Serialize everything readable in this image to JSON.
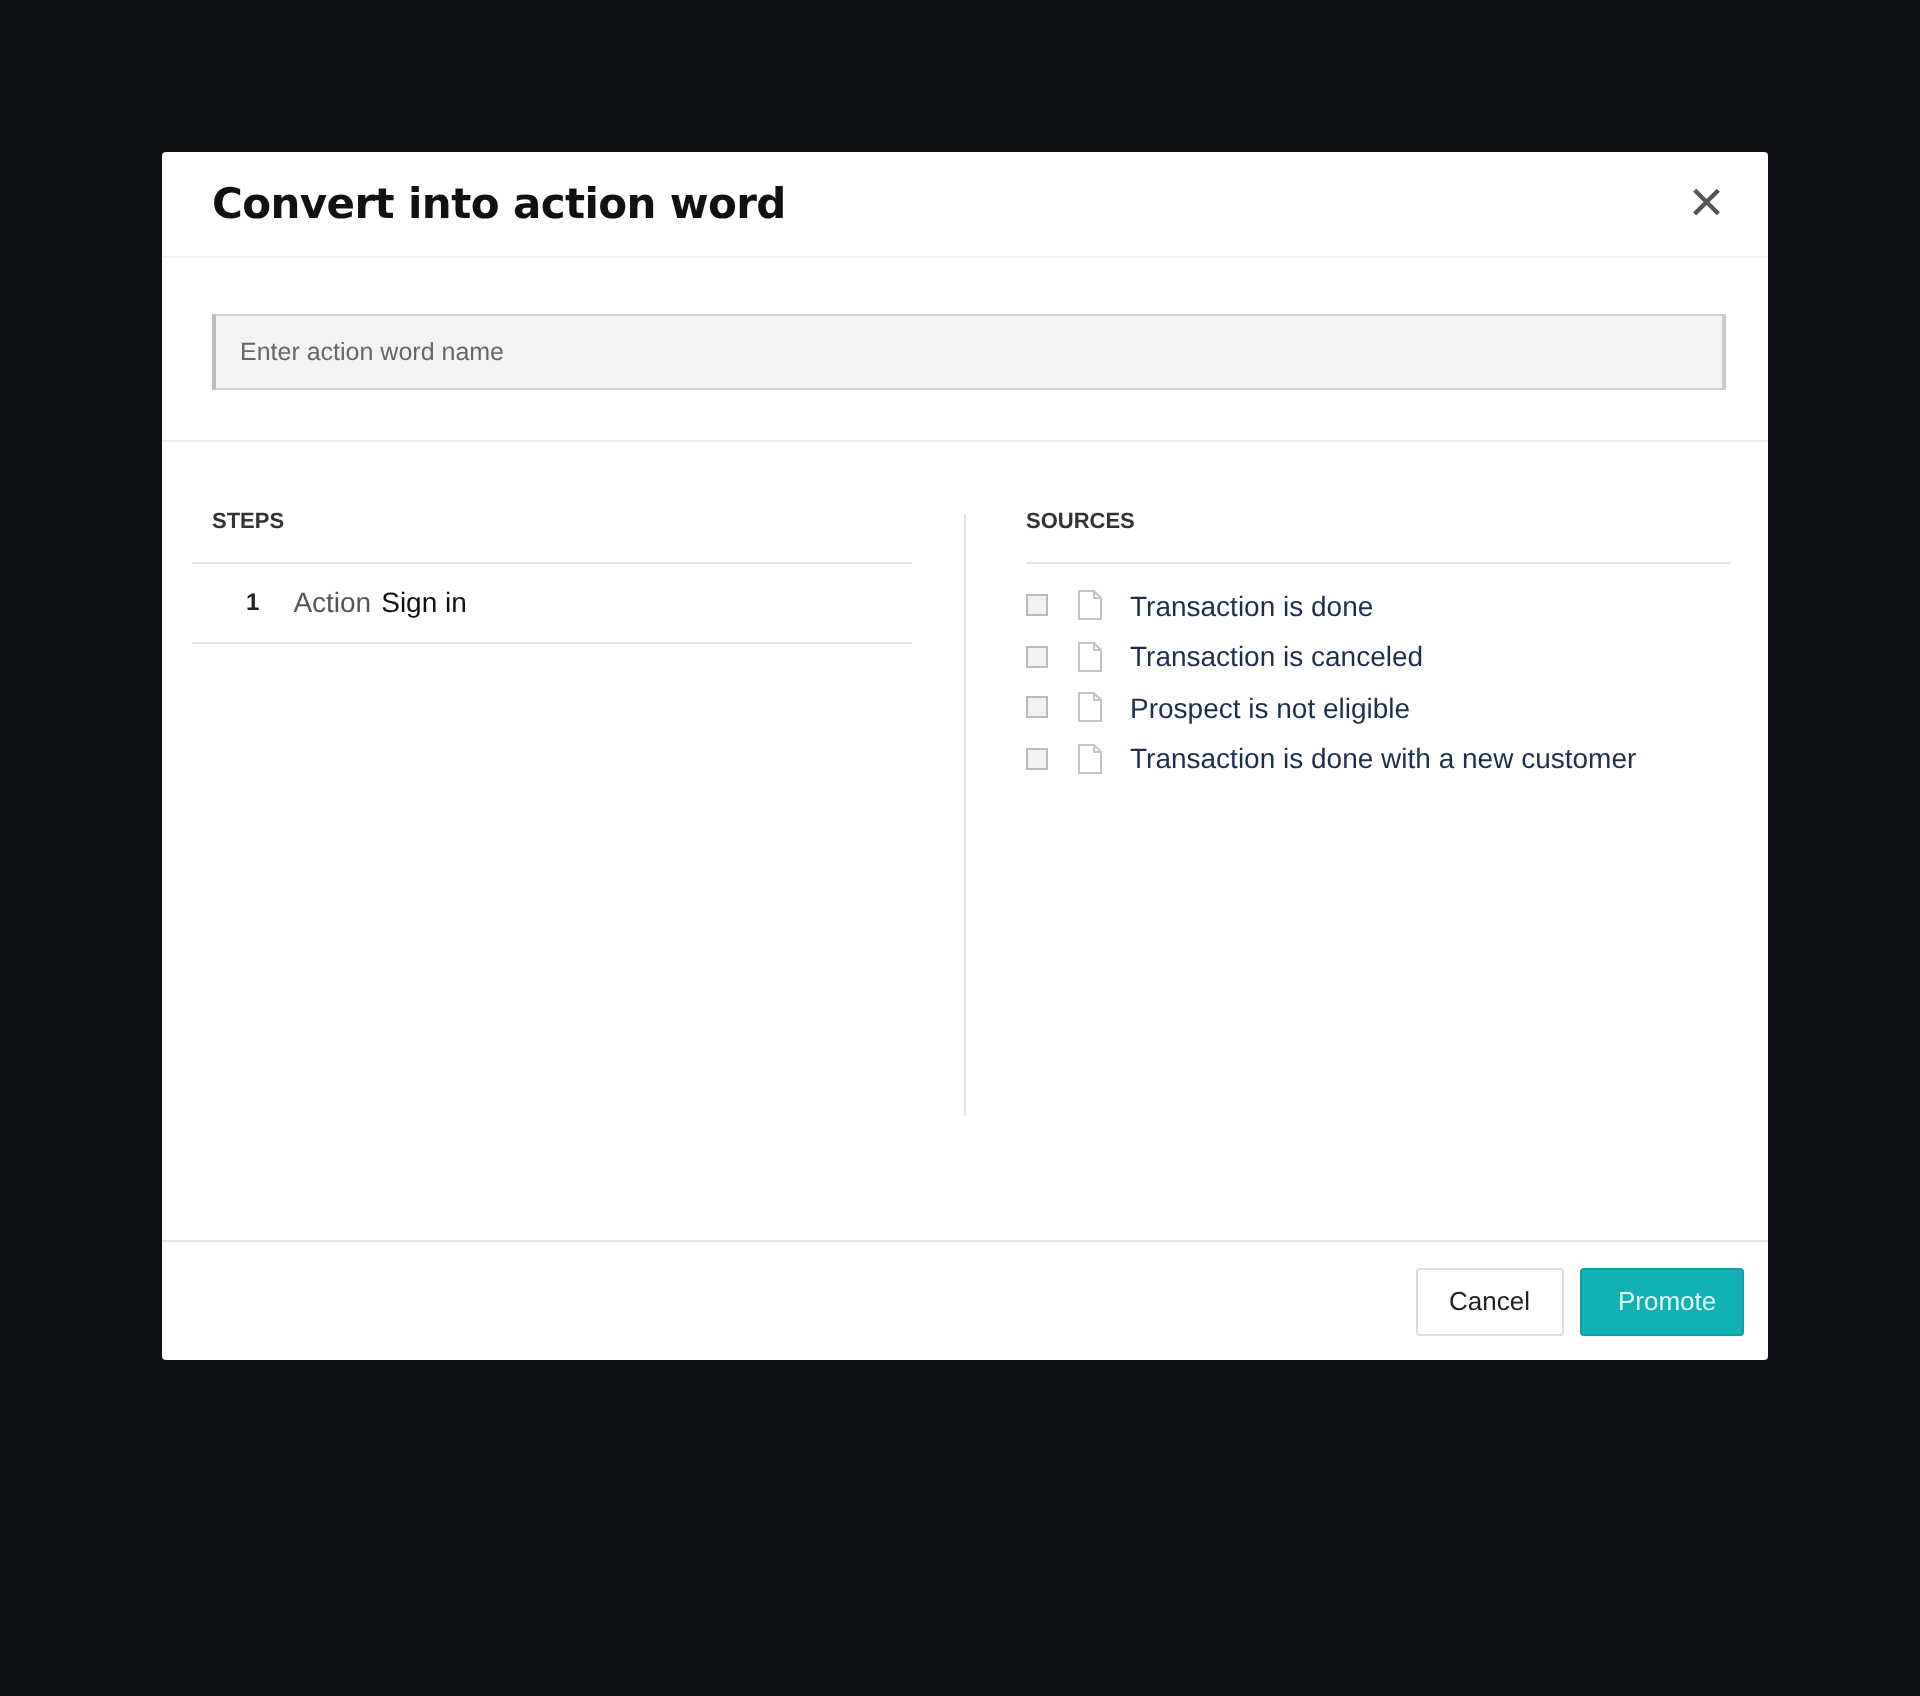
{
  "dialog": {
    "title": "Convert into action word",
    "close_label": "×",
    "name_field": {
      "placeholder": "Enter action word name"
    },
    "steps": {
      "heading": "STEPS",
      "items": [
        {
          "number": "1",
          "keyword": "Action",
          "text": "Sign in"
        }
      ]
    },
    "sources": {
      "heading": "SOURCES",
      "items": [
        {
          "label": "Transaction is done",
          "checked": false
        },
        {
          "label": "Transaction is canceled",
          "checked": false
        },
        {
          "label": "Prospect is not eligible",
          "checked": false
        },
        {
          "label": "Transaction is done with a new customer",
          "checked": false
        }
      ]
    },
    "buttons": [
      {
        "label": "Cancel",
        "kind": "secondary"
      },
      {
        "label": "Promote",
        "kind": "primary"
      }
    ]
  }
}
